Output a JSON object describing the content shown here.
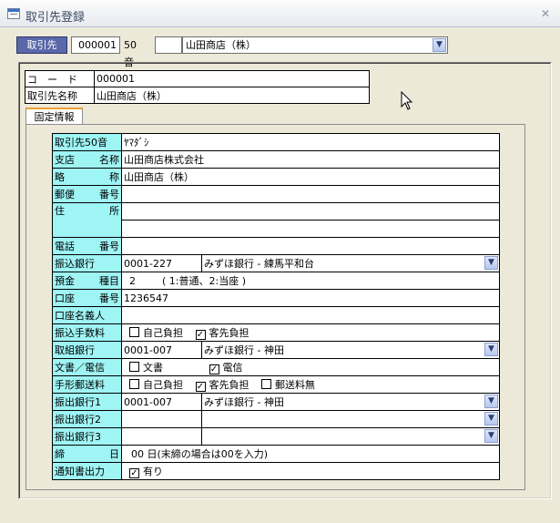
{
  "window": {
    "title": "取引先登録"
  },
  "topbar": {
    "button_label": "取引先",
    "code_value": "000001",
    "goon_label": "50音",
    "goon_value": "",
    "name_value": "山田商店（株）"
  },
  "header": {
    "code_label": "コ　ー　ド",
    "code_value": "000001",
    "name_label": "取引先名称",
    "name_value": "山田商店（株）"
  },
  "tab": {
    "label": "固定情報"
  },
  "detail": {
    "kana_label": "取引先50音",
    "kana_value": "ﾔﾏﾀﾞｼ",
    "branch_label_a": "支店",
    "branch_label_b": "名称",
    "branch_value": "山田商店株式会社",
    "abbr_label_a": "略",
    "abbr_label_b": "称",
    "abbr_value": "山田商店（株）",
    "postal_label_a": "郵便",
    "postal_label_b": "番号",
    "postal_value": "",
    "address_label_a": "住",
    "address_label_b": "所",
    "address_line1": "",
    "address_line2": "",
    "phone_label_a": "電話",
    "phone_label_b": "番号",
    "phone_value": "",
    "transfer_bank_label": "振込銀行",
    "transfer_bank_code": "0001-227",
    "transfer_bank_name": "みずほ銀行 - 練馬平和台",
    "deposit_label_a": "預金",
    "deposit_label_b": "種目",
    "deposit_value": "2",
    "deposit_note": "( 1:普通、2:当座 )",
    "account_label_a": "口座",
    "account_label_b": "番号",
    "account_value": "1236547",
    "holder_label": "口座名義人",
    "holder_value": "",
    "fee_label": "振込手数料",
    "fee_self": "自己負担",
    "fee_customer": "客先負担",
    "fee_self_checked": false,
    "fee_customer_checked": true,
    "trade_bank_label": "取組銀行",
    "trade_bank_code": "0001-007",
    "trade_bank_name": "みずほ銀行 - 神田",
    "doc_label": "文書／電信",
    "doc_option": "文書",
    "wire_option": "電信",
    "doc_checked": false,
    "wire_checked": true,
    "bill_label": "手形郵送料",
    "bill_self": "自己負担",
    "bill_customer": "客先負担",
    "bill_none": "郵送料無",
    "bill_self_checked": false,
    "bill_customer_checked": true,
    "bill_none_checked": false,
    "out1_label": "振出銀行1",
    "out1_code": "0001-007",
    "out1_name": "みずほ銀行 - 神田",
    "out2_label": "振出銀行2",
    "out2_code": "",
    "out2_name": "",
    "out3_label": "振出銀行3",
    "out3_code": "",
    "out3_name": "",
    "closing_label_a": "締",
    "closing_label_b": "日",
    "closing_value": "00",
    "closing_note": "日(末締の場合は00を入力)",
    "notice_label": "通知書出力",
    "notice_option": "有り",
    "notice_checked": true
  },
  "glyphs": {
    "arrow": "▼",
    "check": "✓",
    "close": "✕"
  }
}
